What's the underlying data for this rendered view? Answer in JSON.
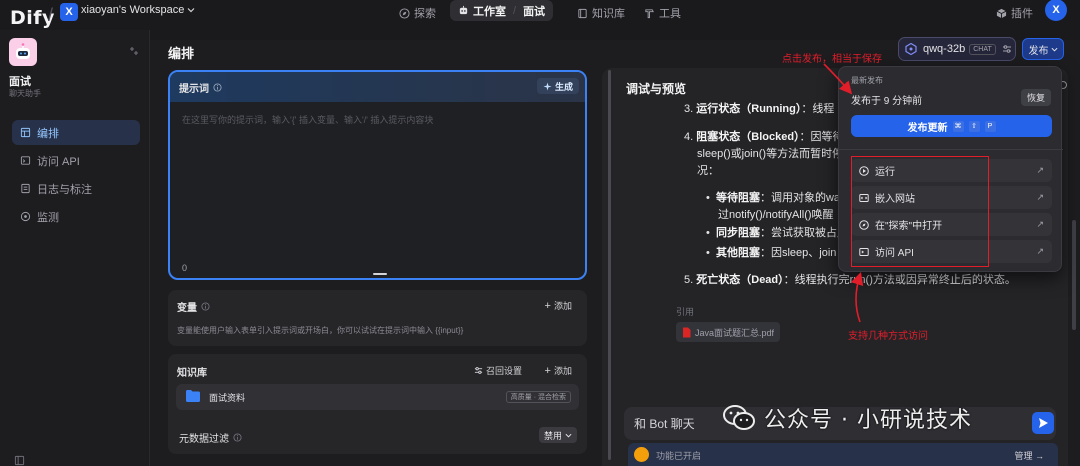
{
  "header": {
    "logo": "Dify",
    "workspace_initial": "X",
    "workspace_name": "xiaoyan's Workspace",
    "nav": {
      "explore": "探索",
      "studio": "工作室",
      "app": "面试",
      "knowledge": "知识库",
      "tools": "工具",
      "plugins": "插件"
    },
    "user_initial": "X"
  },
  "sidebar": {
    "app_name": "面试",
    "app_type": "聊天助手",
    "items": [
      {
        "label": "编排",
        "icon": "layout-icon",
        "active": true
      },
      {
        "label": "访问 API",
        "icon": "terminal-icon",
        "active": false
      },
      {
        "label": "日志与标注",
        "icon": "file-icon",
        "active": false
      },
      {
        "label": "监测",
        "icon": "monitor-icon",
        "active": false
      }
    ]
  },
  "editor": {
    "title": "编排",
    "prompt": {
      "label": "提示词",
      "generate": "生成",
      "placeholder": "在这里写你的提示词，输入'{' 插入变量、输入'/' 插入提示内容块",
      "char_count": "0"
    },
    "variables": {
      "title": "变量",
      "add": "添加",
      "description": "变量能使用户输入表单引入提示词或开场白，你可以试试在提示词中输入 {{input}}"
    },
    "knowledge": {
      "title": "知识库",
      "recall_settings": "召回设置",
      "add": "添加",
      "item_name": "面试资料",
      "item_badge": "高质量 · 混合检索",
      "metadata_filter": "元数据过滤",
      "metadata_value": "禁用"
    }
  },
  "preview": {
    "title": "调试与预览",
    "items": [
      {
        "num": "3.",
        "bold": "运行状态（Running）",
        "text": "：线程"
      },
      {
        "num": "4.",
        "bold": "阻塞状态（Blocked）",
        "text": "：因等待",
        "line2": "sleep()或join()等方法而暂时停",
        "line3": "况："
      }
    ],
    "bullets": [
      {
        "bold": "等待阻塞",
        "text": "：调用对象的wa",
        "line2": "过notify()/notifyAll()唤醒"
      },
      {
        "bold": "同步阻塞",
        "text": "：尝试获取被占用"
      },
      {
        "bold": "其他阻塞",
        "text": "：因sleep、join"
      }
    ],
    "item5": {
      "num": "5.",
      "bold": "死亡状态（Dead）",
      "text": "：线程执行完run()方法或因异常终止后的状态。"
    },
    "citation_label": "引用",
    "citation_file": "Java面试题汇总.pdf",
    "input_placeholder": "和 Bot 聊天",
    "feature_text": "功能已开启",
    "manage": "管理"
  },
  "model": {
    "name": "qwq-32b",
    "mode": "CHAT"
  },
  "publish": {
    "button": "发布",
    "latest_label": "最新发布",
    "published_time": "发布于 9 分钟前",
    "restore": "恢复",
    "update": "发布更新",
    "shortcut": [
      "⌘",
      "⇧",
      "P"
    ],
    "actions": [
      {
        "label": "运行",
        "icon": "play-icon"
      },
      {
        "label": "嵌入网站",
        "icon": "embed-icon"
      },
      {
        "label": "在\"探索\"中打开",
        "icon": "compass-icon"
      },
      {
        "label": "访问 API",
        "icon": "terminal-icon"
      }
    ]
  },
  "annotations": {
    "publish_note": "点击发布，相当于保存",
    "access_note": "支持几种方式访问"
  },
  "watermark": "公众号 · 小研说技术",
  "colors": {
    "accent": "#2563eb",
    "annotation": "#e11d2a",
    "background": "#1d1d20"
  }
}
